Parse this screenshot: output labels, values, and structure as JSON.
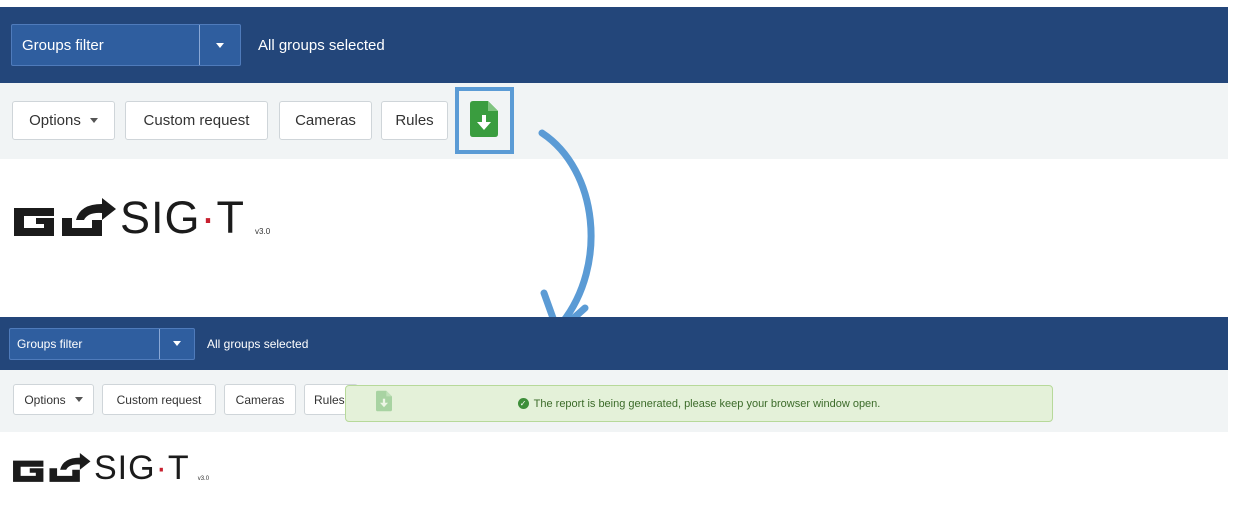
{
  "top": {
    "groups_filter": "Groups filter",
    "groups_status": "All groups selected",
    "toolbar": {
      "options_label": "Options",
      "custom_request_label": "Custom request",
      "cameras_label": "Cameras",
      "rules_label": "Rules",
      "download_icon": "file-download-icon"
    },
    "logo": {
      "word": "SIG",
      "word2": "T",
      "version": "v3.0"
    }
  },
  "bottom": {
    "groups_filter": "Groups filter",
    "groups_status": "All groups selected",
    "toolbar": {
      "options_label": "Options",
      "custom_request_label": "Custom request",
      "cameras_label": "Cameras",
      "rules_label": "Rules"
    },
    "notification": "The report is being generated, please keep your browser window open.",
    "logo": {
      "word": "SIG",
      "word2": "T",
      "version": "v3.0"
    }
  },
  "colors": {
    "header_bg": "#23467a",
    "select_bg": "#2f5e9f",
    "toolbar_bg": "#f1f4f5",
    "download_green": "#3a9d3f",
    "highlight_blue": "#5b9bd5",
    "toast_bg": "#e4f1d9"
  }
}
